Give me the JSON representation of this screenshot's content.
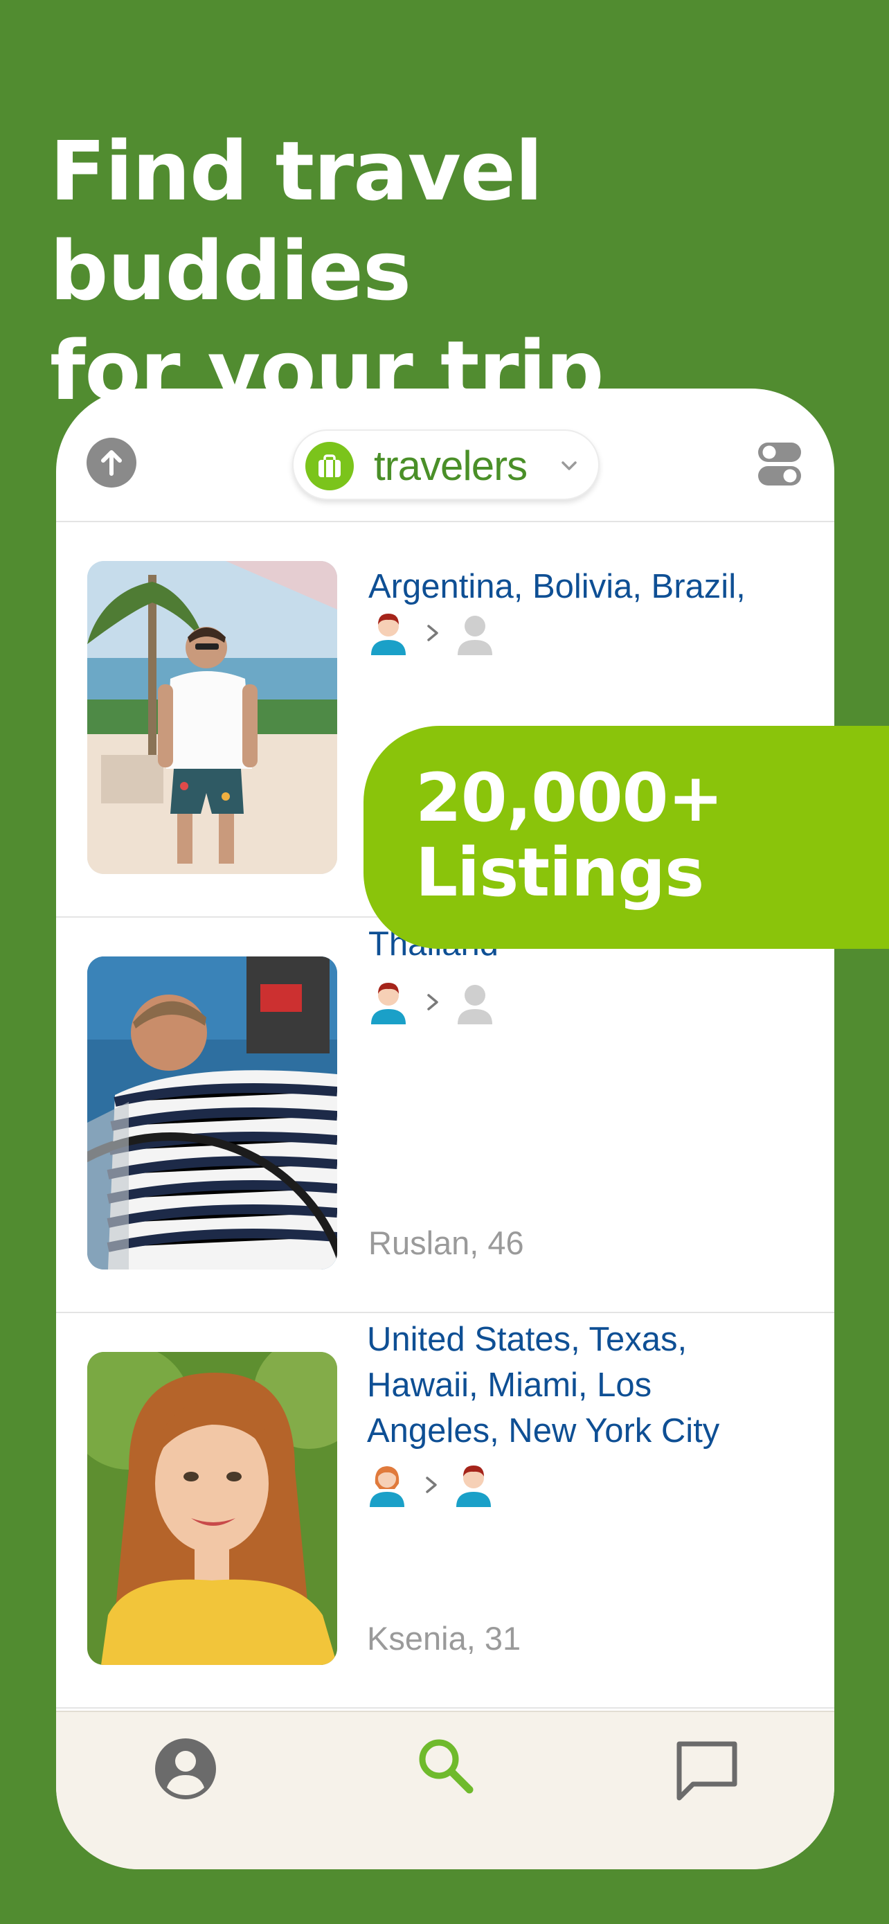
{
  "headline": {
    "line1": "Find travel buddies",
    "line2": "for your trip"
  },
  "topbar": {
    "filter_label": "travelers"
  },
  "badge": {
    "line1": "20,000+",
    "line2": "Listings"
  },
  "listings": [
    {
      "destinations": "Argentina, Bolivia, Brazil,",
      "name_age": ""
    },
    {
      "destinations": "Thailand",
      "name_age": "Ruslan, 46"
    },
    {
      "destinations": "United States, Texas, Hawaii,  Miami,  Los Angeles,  New York City",
      "name_age": "Ksenia, 31"
    }
  ],
  "icons": {
    "scroll_up": "arrow-up-icon",
    "filter": "suitcase-icon",
    "settings": "toggle-icon",
    "nav_profile": "profile-icon",
    "nav_search": "search-icon",
    "nav_chat": "chat-icon"
  },
  "colors": {
    "background": "#518c30",
    "accent": "#8ac40b",
    "link_blue": "#0e4f94",
    "active_nav": "#6fba2c"
  }
}
